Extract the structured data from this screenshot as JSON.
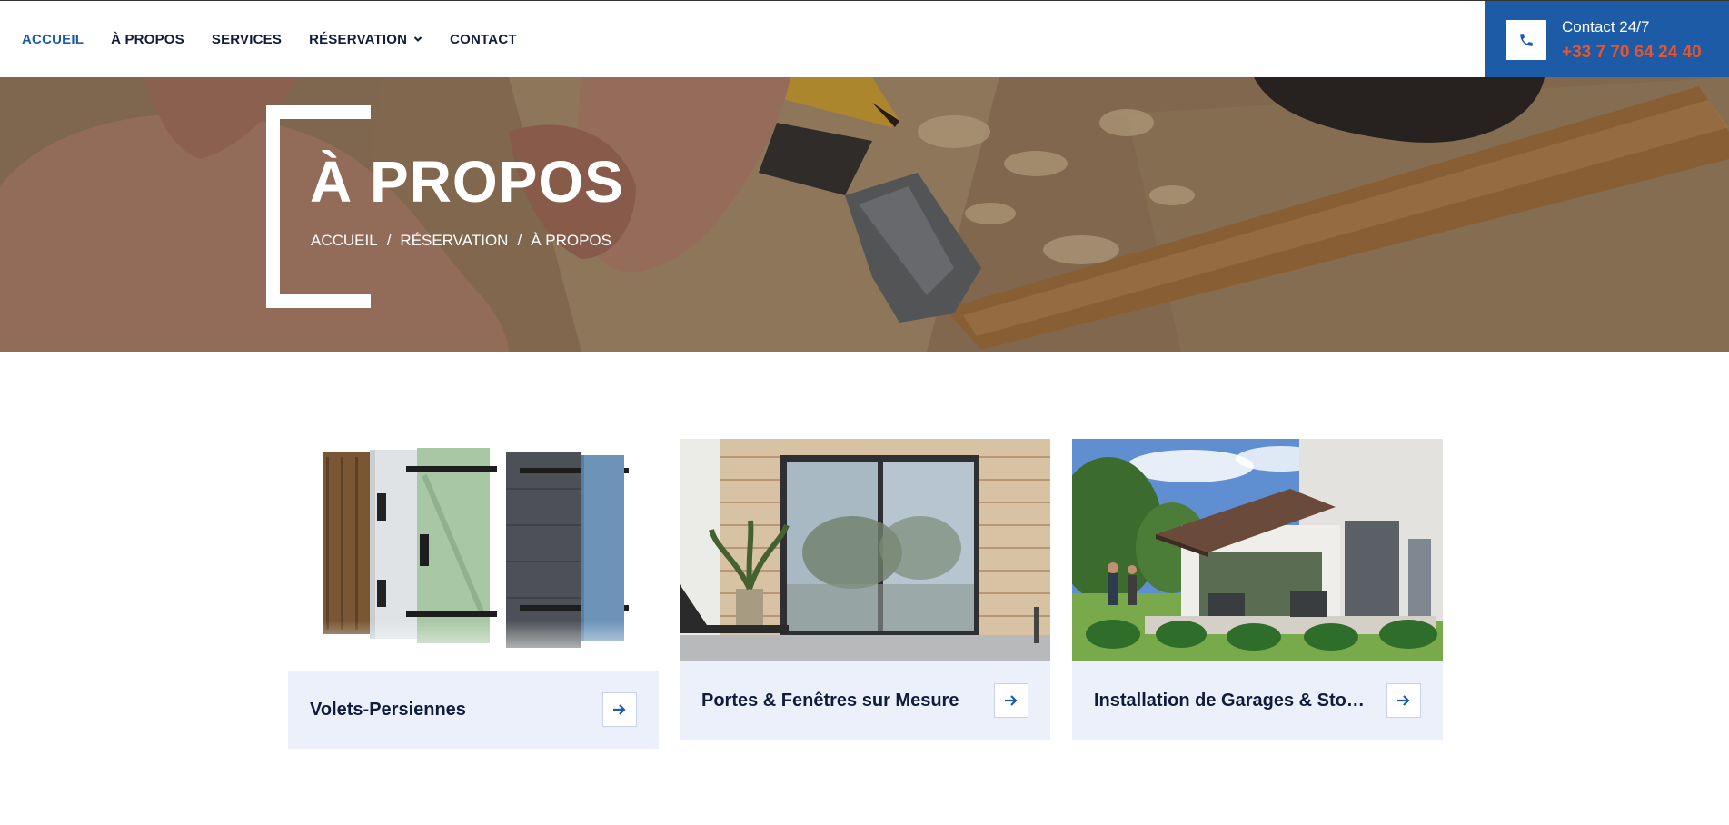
{
  "nav": {
    "items": [
      {
        "label": "ACCUEIL",
        "active": true
      },
      {
        "label": "À PROPOS"
      },
      {
        "label": "SERVICES"
      },
      {
        "label": "RÉSERVATION",
        "has_dropdown": true
      },
      {
        "label": "CONTACT"
      }
    ]
  },
  "contact": {
    "label": "Contact 24/7",
    "phone": "+33 7 70 64 24 40",
    "icon": "phone-icon"
  },
  "hero": {
    "title": "À PROPOS",
    "breadcrumb": [
      "ACCUEIL",
      "RÉSERVATION",
      "À PROPOS"
    ],
    "separator": "/"
  },
  "cards": [
    {
      "title": "Volets-Persiennes",
      "image": "shutters-image",
      "arrow_icon": "arrow-right-icon"
    },
    {
      "title": "Portes & Fenêtres sur Mesure",
      "image": "sliding-door-image",
      "arrow_icon": "arrow-right-icon"
    },
    {
      "title": "Installation de Garages & Stores Bannes",
      "image": "awning-house-image",
      "arrow_icon": "arrow-right-icon"
    }
  ],
  "colors": {
    "accent": "#1e5ba6",
    "phone": "#e8552a",
    "text": "#0f1c3d",
    "card_bg": "#ebf0fa"
  }
}
